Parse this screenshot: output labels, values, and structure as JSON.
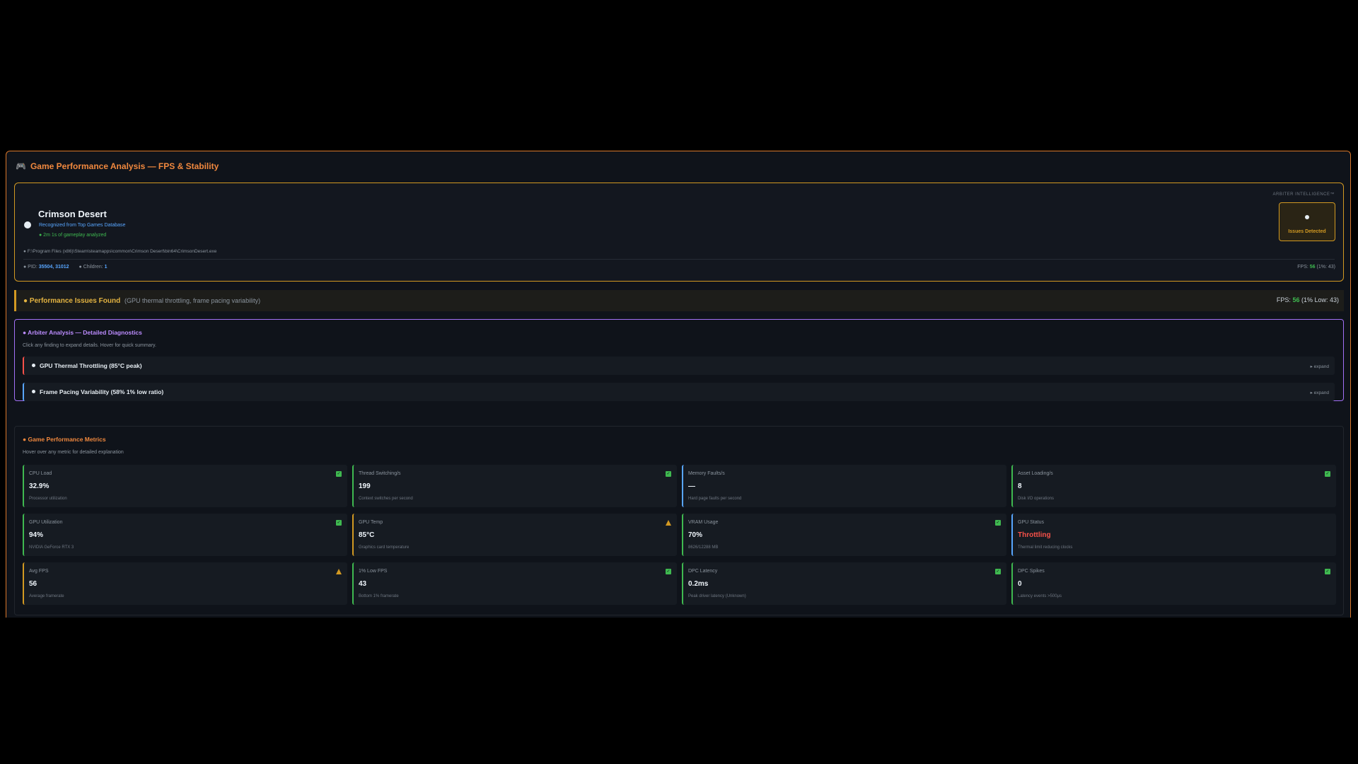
{
  "panel": {
    "title": "Game Performance Analysis — FPS & Stability",
    "icon": "gamepad-icon"
  },
  "game": {
    "name": "Crimson Desert",
    "source": "Recognized from Top Games Database",
    "analyzed": "● 2m 1s of gameplay analyzed",
    "path": "● F:\\Program Files (x86)\\Steam\\steamapps\\common\\Crimson Desert\\bin64\\CrimsonDesert.exe",
    "pid_label": "● PID:",
    "pid_value": "35504, 31012",
    "children_label": "● Children:",
    "children_value": "1",
    "fps_label": "FPS:",
    "fps_value": "56",
    "fps_low": "(1%: 43)",
    "arbiter_label": "ARBITER INTELLIGENCE™",
    "issues_status": "Issues Detected"
  },
  "issues_banner": {
    "title": "● Performance Issues Found",
    "subtitle": "(GPU thermal throttling, frame pacing variability)",
    "fps_label": "FPS:",
    "fps_value": "56",
    "fps_low": "(1% Low: 43)"
  },
  "analysis": {
    "title": "● Arbiter Analysis — Detailed Diagnostics",
    "hint": "Click any finding to expand details. Hover for quick summary.",
    "findings": [
      {
        "text": "GPU Thermal Throttling (85°C peak)",
        "expand": "▸ expand"
      },
      {
        "text": "Frame Pacing Variability (58% 1% low ratio)",
        "expand": "▸ expand"
      }
    ]
  },
  "metrics": {
    "title": "● Game Performance Metrics",
    "hint": "Hover over any metric for detailed explanation",
    "cards": [
      {
        "label": "CPU Load",
        "value": "32.9%",
        "sub": "Processor utilization",
        "status": "ok"
      },
      {
        "label": "Thread Switching/s",
        "value": "199",
        "sub": "Context switches per second",
        "status": "ok"
      },
      {
        "label": "Memory Faults/s",
        "value": "—",
        "sub": "Hard page faults per second",
        "status": "none"
      },
      {
        "label": "Asset Loading/s",
        "value": "8",
        "sub": "Disk I/O operations",
        "status": "ok"
      },
      {
        "label": "GPU Utilization",
        "value": "94%",
        "sub": "NVIDIA GeForce RTX 3",
        "status": "ok"
      },
      {
        "label": "GPU Temp",
        "value": "85°C",
        "sub": "Graphics card temperature",
        "status": "warn"
      },
      {
        "label": "VRAM Usage",
        "value": "70%",
        "sub": "8626/12288 MB",
        "status": "ok"
      },
      {
        "label": "GPU Status",
        "value": "Throttling",
        "sub": "Thermal limit reducing clocks",
        "status": "none"
      },
      {
        "label": "Avg FPS",
        "value": "56",
        "sub": "Average framerate",
        "status": "warn"
      },
      {
        "label": "1% Low FPS",
        "value": "43",
        "sub": "Bottom 1% framerate",
        "status": "ok"
      },
      {
        "label": "DPC Latency",
        "value": "0.2ms",
        "sub": "Peak driver latency (Unknown)",
        "status": "ok"
      },
      {
        "label": "DPC Spikes",
        "value": "0",
        "sub": "Latency events >500μs",
        "status": "ok"
      }
    ]
  },
  "colors": {
    "accent_orange": "#f0883e",
    "warning": "#d29922",
    "success": "#3fb950",
    "danger": "#f85149",
    "info": "#58a6ff",
    "purple": "#a371f7"
  }
}
